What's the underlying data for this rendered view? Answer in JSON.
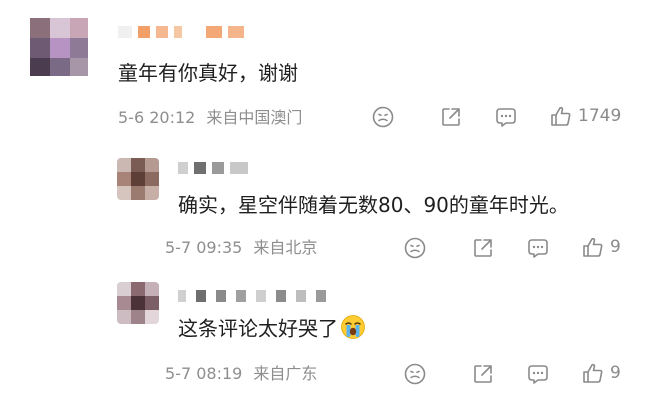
{
  "comments": [
    {
      "text": "童年有你真好，谢谢",
      "date": "5-6 20:12",
      "location": "来自中国澳门",
      "like_count": "1749"
    },
    {
      "text": "确实，星空伴随着无数80、90的童年时光。",
      "date": "5-7 09:35",
      "location": "来自北京",
      "like_count": "9"
    },
    {
      "text": "这条评论太好哭了",
      "date": "5-7 08:19",
      "location": "来自广东",
      "like_count": "9"
    }
  ],
  "icons": {
    "emoji_reaction": "smiley-face-icon",
    "share": "share-icon",
    "reply": "comment-bubble-icon",
    "like": "thumbs-up-icon",
    "inline_emoji": "loudly-crying-face-emoji"
  },
  "colors": {
    "text": "#1f1f1f",
    "meta": "#8e8e8e",
    "icon": "#8a8a8a"
  }
}
